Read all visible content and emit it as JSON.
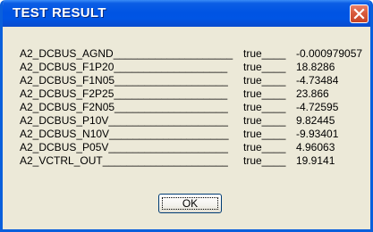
{
  "window": {
    "title": "TEST RESULT"
  },
  "results": [
    {
      "name": "A2_DCBUS_AGND____________________",
      "status": "true____",
      "value": "-0.000979057"
    },
    {
      "name": "A2_DCBUS_F1P20___________________",
      "status": "true____",
      "value": "18.8286"
    },
    {
      "name": "A2_DCBUS_F1N05___________________",
      "status": "true____",
      "value": "-4.73484"
    },
    {
      "name": "A2_DCBUS_F2P25___________________",
      "status": "true____",
      "value": "23.866"
    },
    {
      "name": "A2_DCBUS_F2N05___________________",
      "status": "true____",
      "value": "-4.72595"
    },
    {
      "name": "A2_DCBUS_P10V____________________",
      "status": "true____",
      "value": "9.82445"
    },
    {
      "name": "A2_DCBUS_N10V____________________",
      "status": "true____",
      "value": "-9.93401"
    },
    {
      "name": "A2_DCBUS_P05V____________________",
      "status": "true____",
      "value": "4.96063"
    },
    {
      "name": "A2_VCTRL_OUT_____________________",
      "status": "true____",
      "value": "19.9141"
    }
  ],
  "buttons": {
    "ok_label": "OK"
  },
  "icons": {
    "close": "close-icon"
  }
}
